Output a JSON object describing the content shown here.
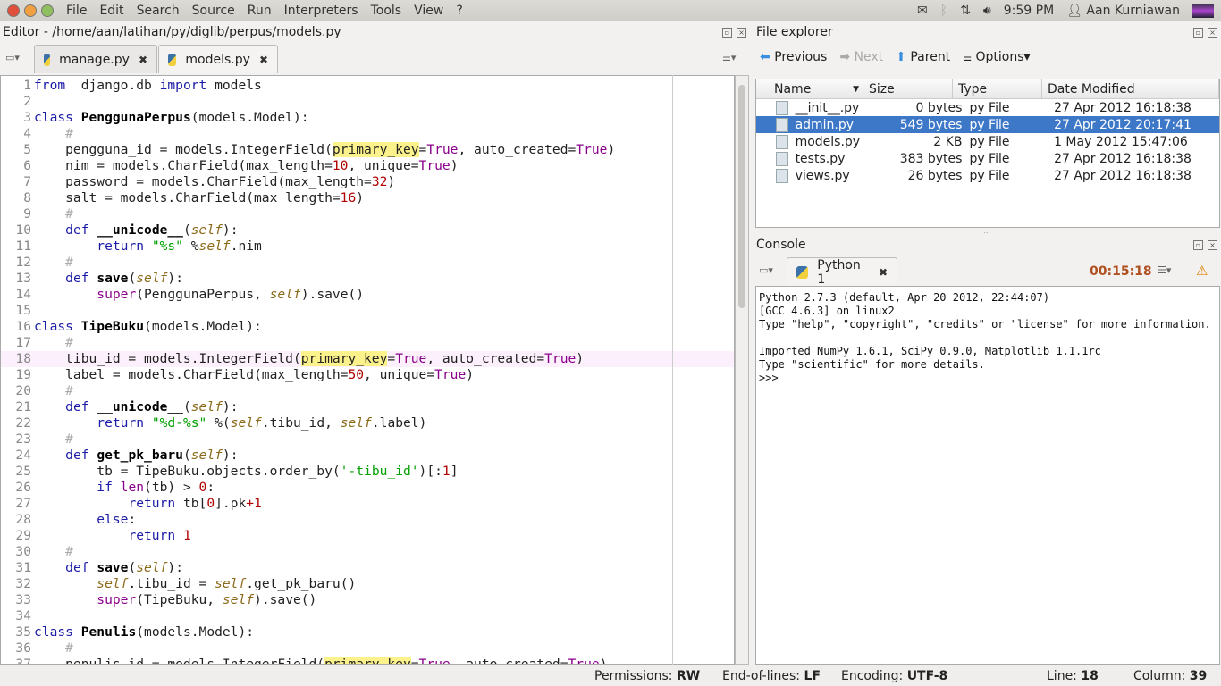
{
  "menubar": {
    "items": [
      "File",
      "Edit",
      "Search",
      "Source",
      "Run",
      "Interpreters",
      "Tools",
      "View",
      "?"
    ],
    "time": "9:59 PM",
    "user": "Aan Kurniawan"
  },
  "editor": {
    "title": "Editor - /home/aan/latihan/py/diglib/perpus/models.py",
    "tabs": [
      {
        "label": "manage.py",
        "active": false
      },
      {
        "label": "models.py",
        "active": true
      }
    ],
    "current_line": 18,
    "lines": [
      [
        [
          "k",
          "from"
        ],
        [
          "",
          "  django.db "
        ],
        [
          "k",
          "import"
        ],
        [
          "",
          " models"
        ]
      ],
      [],
      [
        [
          "k",
          "class"
        ],
        [
          "",
          " "
        ],
        [
          "b",
          "PenggunaPerpus"
        ],
        [
          "",
          "(models.Model):"
        ]
      ],
      [
        [
          "",
          "    "
        ],
        [
          "c",
          "#"
        ]
      ],
      [
        [
          "",
          "    pengguna_id = models.IntegerField("
        ],
        [
          "h",
          "primary_key"
        ],
        [
          "",
          "="
        ],
        [
          "p",
          "True"
        ],
        [
          "",
          ", auto_created="
        ],
        [
          "p",
          "True"
        ],
        [
          "",
          ")"
        ]
      ],
      [
        [
          "",
          "    nim = models.CharField(max_length="
        ],
        [
          "n",
          "10"
        ],
        [
          "",
          ", unique="
        ],
        [
          "p",
          "True"
        ],
        [
          "",
          ")"
        ]
      ],
      [
        [
          "",
          "    password = models.CharField(max_length="
        ],
        [
          "n",
          "32"
        ],
        [
          "",
          ")"
        ]
      ],
      [
        [
          "",
          "    salt = models.CharField(max_length="
        ],
        [
          "n",
          "16"
        ],
        [
          "",
          ")"
        ]
      ],
      [
        [
          "",
          "    "
        ],
        [
          "c",
          "#"
        ]
      ],
      [
        [
          "",
          "    "
        ],
        [
          "k",
          "def"
        ],
        [
          "",
          " "
        ],
        [
          "b",
          "__unicode__"
        ],
        [
          "",
          "("
        ],
        [
          "sf",
          "self"
        ],
        [
          "",
          "):"
        ]
      ],
      [
        [
          "",
          "        "
        ],
        [
          "k",
          "return"
        ],
        [
          "",
          " "
        ],
        [
          "s",
          "\"%s\""
        ],
        [
          "",
          " %"
        ],
        [
          "sf",
          "self"
        ],
        [
          "",
          ".nim"
        ]
      ],
      [
        [
          "",
          "    "
        ],
        [
          "c",
          "#"
        ]
      ],
      [
        [
          "",
          "    "
        ],
        [
          "k",
          "def"
        ],
        [
          "",
          " "
        ],
        [
          "b",
          "save"
        ],
        [
          "",
          "("
        ],
        [
          "sf",
          "self"
        ],
        [
          "",
          "):"
        ]
      ],
      [
        [
          "",
          "        "
        ],
        [
          "p",
          "super"
        ],
        [
          "",
          "(PenggunaPerpus, "
        ],
        [
          "sf",
          "self"
        ],
        [
          "",
          ").save()"
        ]
      ],
      [],
      [
        [
          "k",
          "class"
        ],
        [
          "",
          " "
        ],
        [
          "b",
          "TipeBuku"
        ],
        [
          "",
          "(models.Model):"
        ]
      ],
      [
        [
          "",
          "    "
        ],
        [
          "c",
          "#"
        ]
      ],
      [
        [
          "",
          "    tibu_id = models.IntegerField("
        ],
        [
          "h",
          "primary_key"
        ],
        [
          "",
          "="
        ],
        [
          "p",
          "True"
        ],
        [
          "",
          ", auto_created="
        ],
        [
          "p",
          "True"
        ],
        [
          "",
          ")"
        ]
      ],
      [
        [
          "",
          "    label = models.CharField(max_length="
        ],
        [
          "n",
          "50"
        ],
        [
          "",
          ", unique="
        ],
        [
          "p",
          "True"
        ],
        [
          "",
          ")"
        ]
      ],
      [
        [
          "",
          "    "
        ],
        [
          "c",
          "#"
        ]
      ],
      [
        [
          "",
          "    "
        ],
        [
          "k",
          "def"
        ],
        [
          "",
          " "
        ],
        [
          "b",
          "__unicode__"
        ],
        [
          "",
          "("
        ],
        [
          "sf",
          "self"
        ],
        [
          "",
          "):"
        ]
      ],
      [
        [
          "",
          "        "
        ],
        [
          "k",
          "return"
        ],
        [
          "",
          " "
        ],
        [
          "s",
          "\"%d-%s\""
        ],
        [
          "",
          " %("
        ],
        [
          "sf",
          "self"
        ],
        [
          "",
          ".tibu_id, "
        ],
        [
          "sf",
          "self"
        ],
        [
          "",
          ".label)"
        ]
      ],
      [
        [
          "",
          "    "
        ],
        [
          "c",
          "#"
        ]
      ],
      [
        [
          "",
          "    "
        ],
        [
          "k",
          "def"
        ],
        [
          "",
          " "
        ],
        [
          "b",
          "get_pk_baru"
        ],
        [
          "",
          "("
        ],
        [
          "sf",
          "self"
        ],
        [
          "",
          "):"
        ]
      ],
      [
        [
          "",
          "        tb = TipeBuku.objects.order_by("
        ],
        [
          "s",
          "'-tibu_id'"
        ],
        [
          "",
          ")[:"
        ],
        [
          "n",
          "1"
        ],
        [
          "",
          "]"
        ]
      ],
      [
        [
          "",
          "        "
        ],
        [
          "k",
          "if"
        ],
        [
          "",
          " "
        ],
        [
          "p",
          "len"
        ],
        [
          "",
          "(tb) > "
        ],
        [
          "n",
          "0"
        ],
        [
          "",
          ":"
        ]
      ],
      [
        [
          "",
          "            "
        ],
        [
          "k",
          "return"
        ],
        [
          "",
          " tb["
        ],
        [
          "n",
          "0"
        ],
        [
          "",
          "].pk"
        ],
        [
          "n",
          "+1"
        ]
      ],
      [
        [
          "",
          "        "
        ],
        [
          "k",
          "else"
        ],
        [
          "",
          ":"
        ]
      ],
      [
        [
          "",
          "            "
        ],
        [
          "k",
          "return"
        ],
        [
          "",
          " "
        ],
        [
          "n",
          "1"
        ]
      ],
      [
        [
          "",
          "    "
        ],
        [
          "c",
          "#"
        ]
      ],
      [
        [
          "",
          "    "
        ],
        [
          "k",
          "def"
        ],
        [
          "",
          " "
        ],
        [
          "b",
          "save"
        ],
        [
          "",
          "("
        ],
        [
          "sf",
          "self"
        ],
        [
          "",
          "):"
        ]
      ],
      [
        [
          "",
          "        "
        ],
        [
          "sf",
          "self"
        ],
        [
          "",
          ".tibu_id = "
        ],
        [
          "sf",
          "self"
        ],
        [
          "",
          ".get_pk_baru()"
        ]
      ],
      [
        [
          "",
          "        "
        ],
        [
          "p",
          "super"
        ],
        [
          "",
          "(TipeBuku, "
        ],
        [
          "sf",
          "self"
        ],
        [
          "",
          ").save()"
        ]
      ],
      [],
      [
        [
          "k",
          "class"
        ],
        [
          "",
          " "
        ],
        [
          "b",
          "Penulis"
        ],
        [
          "",
          "(models.Model):"
        ]
      ],
      [
        [
          "",
          "    "
        ],
        [
          "c",
          "#"
        ]
      ],
      [
        [
          "",
          "    penulis_id = models.IntegerField("
        ],
        [
          "h",
          "primary_key"
        ],
        [
          "",
          "="
        ],
        [
          "p",
          "True"
        ],
        [
          "",
          ", auto_created="
        ],
        [
          "p",
          "True"
        ],
        [
          "",
          ")"
        ]
      ]
    ]
  },
  "status": {
    "permissions_label": "Permissions:",
    "permissions": "RW",
    "eol_label": "End-of-lines:",
    "eol": "LF",
    "encoding_label": "Encoding:",
    "encoding": "UTF-8",
    "line_label": "Line:",
    "line": "18",
    "column_label": "Column:",
    "column": "39"
  },
  "explorer": {
    "title": "File explorer",
    "previous": "Previous",
    "next": "Next",
    "parent": "Parent",
    "options": "Options",
    "columns": [
      "Name",
      "Size",
      "Type",
      "Date Modified"
    ],
    "files": [
      {
        "name": "__init__.py",
        "size": "0 bytes",
        "type": "py File",
        "date": "27 Apr 2012 16:18:38"
      },
      {
        "name": "admin.py",
        "size": "549 bytes",
        "type": "py File",
        "date": "27 Apr 2012 20:17:41",
        "selected": true
      },
      {
        "name": "models.py",
        "size": "2 KB",
        "type": "py File",
        "date": "1 May 2012 15:47:06"
      },
      {
        "name": "tests.py",
        "size": "383 bytes",
        "type": "py File",
        "date": "27 Apr 2012 16:18:38"
      },
      {
        "name": "views.py",
        "size": "26 bytes",
        "type": "py File",
        "date": "27 Apr 2012 16:18:38"
      }
    ]
  },
  "console": {
    "title": "Console",
    "tab": "Python 1",
    "elapsed": "00:15:18",
    "lines": [
      "Python 2.7.3 (default, Apr 20 2012, 22:44:07)",
      "[GCC 4.6.3] on linux2",
      "Type \"help\", \"copyright\", \"credits\" or \"license\" for more information.",
      "",
      "Imported NumPy 1.6.1, SciPy 0.9.0, Matplotlib 1.1.1rc",
      "Type \"scientific\" for more details.",
      ">>>"
    ]
  },
  "colors": {
    "selection": "#3d78c8",
    "current_line": "#fdf0fd",
    "occurrence_highlight": "#fbf28c",
    "elapsed": "#b05020"
  }
}
